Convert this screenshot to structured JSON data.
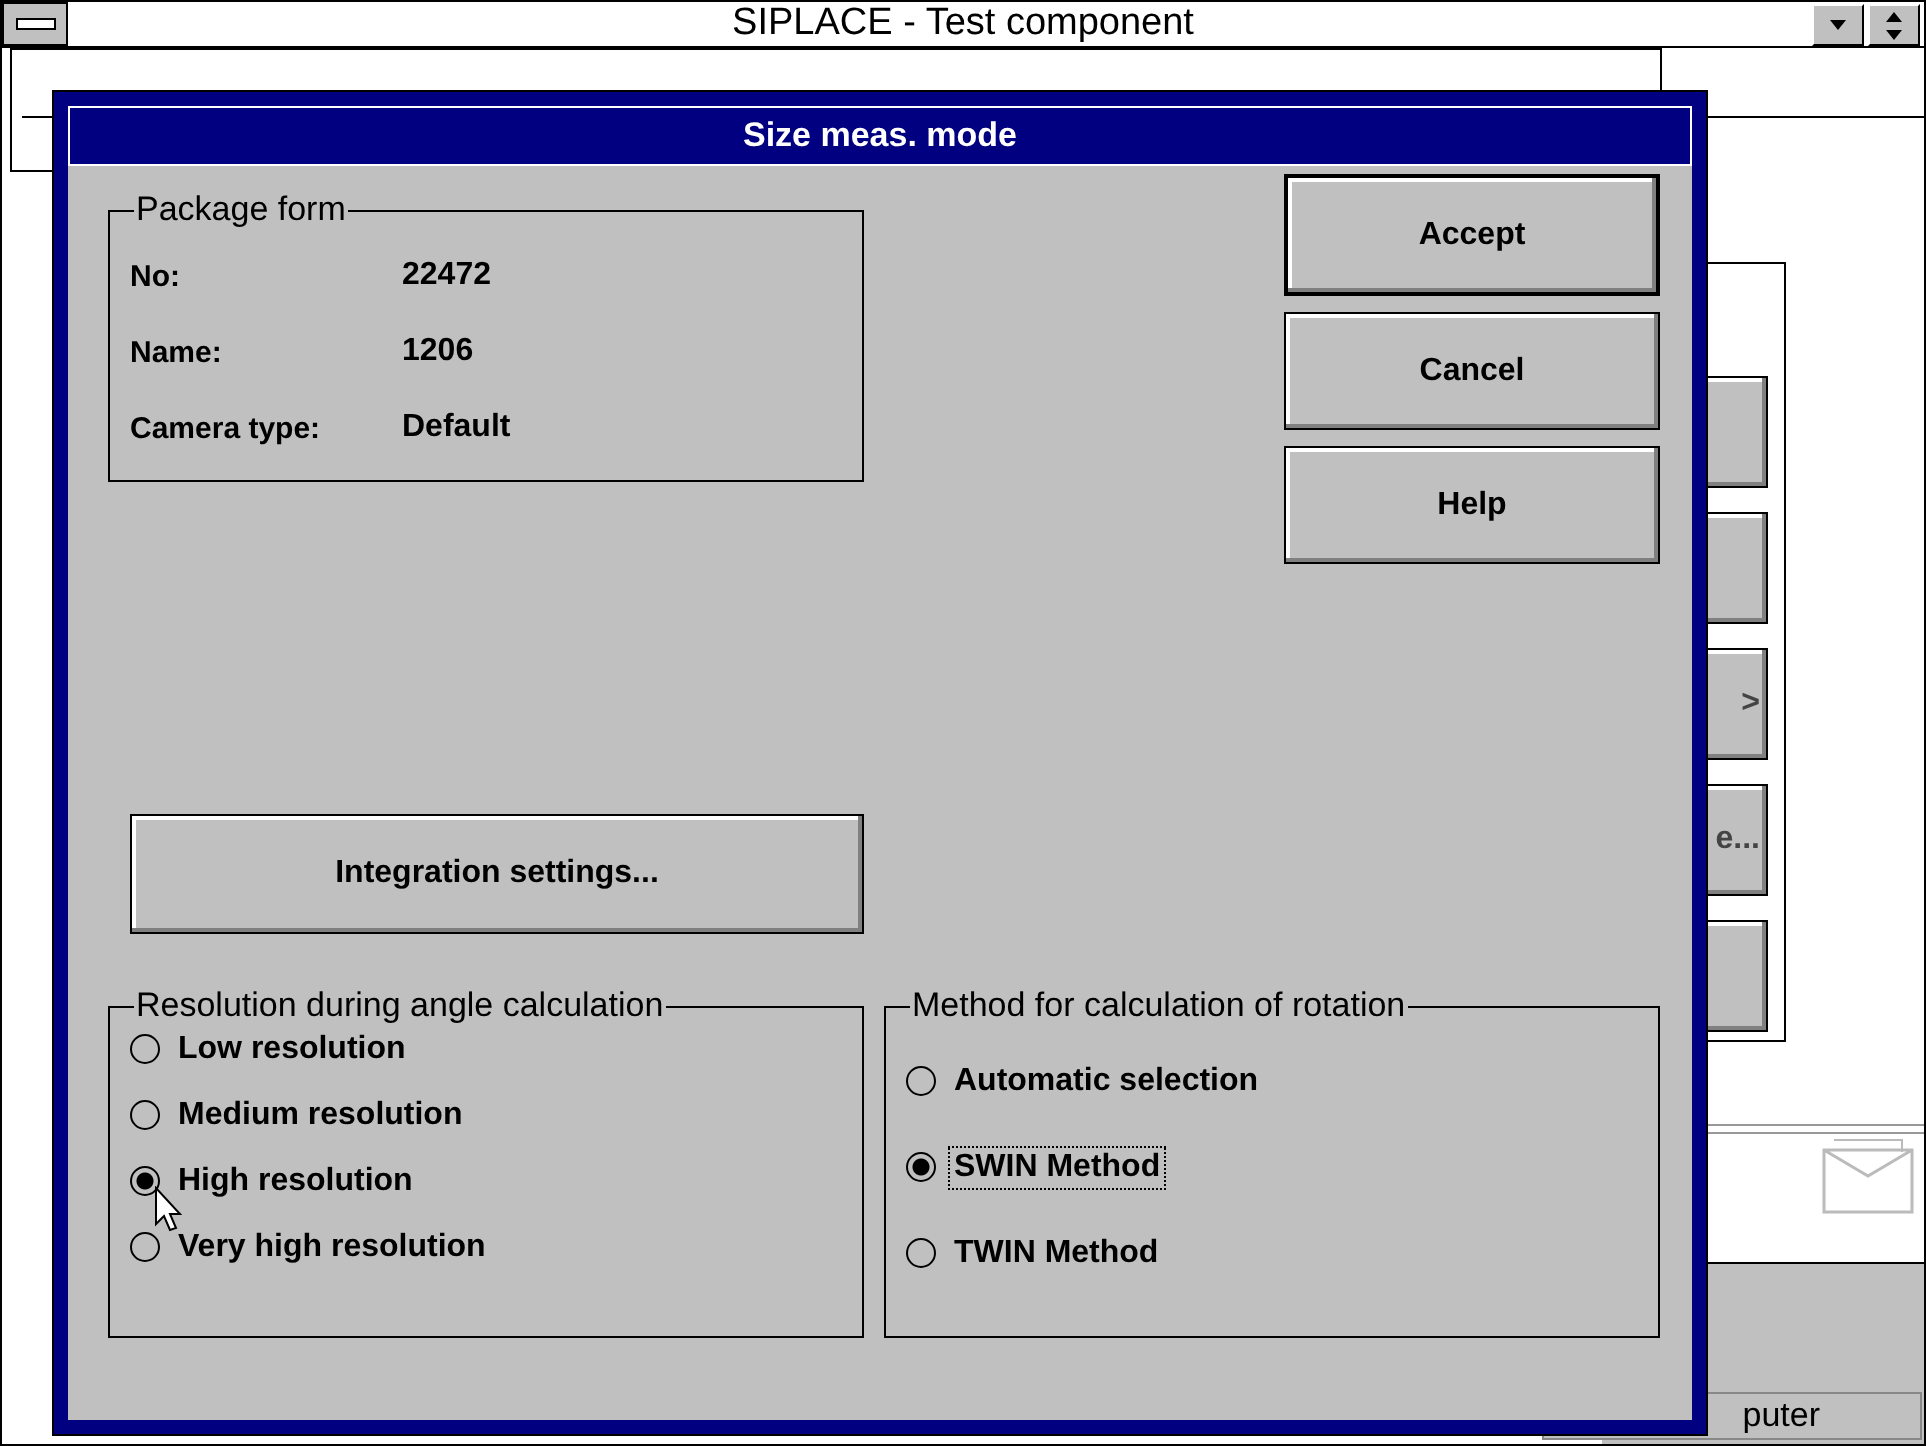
{
  "main_window": {
    "title": "SIPLACE - Test component"
  },
  "back_window": {
    "side_buttons": [
      {
        "kind": "blank"
      },
      {
        "kind": "blank"
      },
      {
        "kind": "text",
        "label": ">"
      },
      {
        "kind": "text",
        "label": "e..."
      },
      {
        "kind": "blank"
      }
    ]
  },
  "status_bar": {
    "text": "puter"
  },
  "dialog": {
    "title": "Size meas. mode",
    "package_form": {
      "title": "Package form",
      "fields": [
        {
          "label": "No:",
          "value": "22472"
        },
        {
          "label": "Name:",
          "value": "1206"
        },
        {
          "label": "Camera type:",
          "value": "Default"
        }
      ]
    },
    "buttons": [
      {
        "label": "Accept",
        "default": true
      },
      {
        "label": "Cancel",
        "default": false
      },
      {
        "label": "Help",
        "default": false
      }
    ],
    "integration_button": "Integration settings...",
    "resolution_group": {
      "title": "Resolution during angle calculation",
      "options": [
        {
          "label": "Low resolution",
          "selected": false,
          "focused": false
        },
        {
          "label": "Medium resolution",
          "selected": false,
          "focused": false
        },
        {
          "label": "High resolution",
          "selected": true,
          "focused": false
        },
        {
          "label": "Very high resolution",
          "selected": false,
          "focused": false
        }
      ]
    },
    "rotation_group": {
      "title": "Method for calculation of rotation",
      "options": [
        {
          "label": "Automatic selection",
          "selected": false,
          "focused": false
        },
        {
          "label": "SWIN Method",
          "selected": true,
          "focused": true
        },
        {
          "label": "TWIN Method",
          "selected": false,
          "focused": false
        }
      ]
    }
  }
}
